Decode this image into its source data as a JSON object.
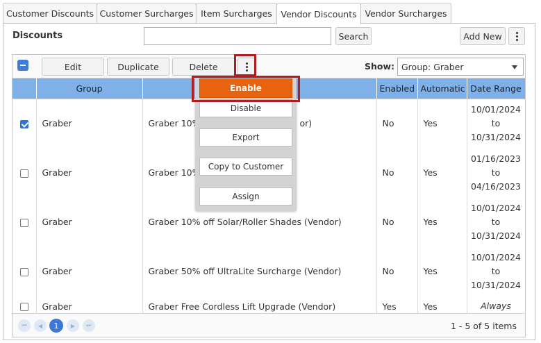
{
  "tabs": [
    {
      "label": "Customer Discounts",
      "active": false
    },
    {
      "label": "Customer Surcharges",
      "active": false
    },
    {
      "label": "Item Surcharges",
      "active": false
    },
    {
      "label": "Vendor Discounts",
      "active": true
    },
    {
      "label": "Vendor Surcharges",
      "active": false
    }
  ],
  "panel": {
    "title": "Discounts",
    "search_value": "",
    "search_label": "Search",
    "add_new_label": "Add New"
  },
  "toolbar": {
    "edit_label": "Edit",
    "duplicate_label": "Duplicate",
    "delete_label": "Delete",
    "show_label": "Show:",
    "show_value": "Group: Graber"
  },
  "columns": [
    "Group",
    "",
    "Enabled",
    "Automatic",
    "Date Range"
  ],
  "rows": [
    {
      "checked": true,
      "group": "Graber",
      "name": "Graber 10% ",
      "name_tail": "or)",
      "enabled": "No",
      "automatic": "Yes",
      "date_from": "10/01/2024",
      "date_to_word": "to",
      "date_to": "10/31/2024"
    },
    {
      "checked": false,
      "group": "Graber",
      "name": "Graber 10%",
      "name_tail": "",
      "enabled": "No",
      "automatic": "Yes",
      "date_from": "01/16/2023",
      "date_to_word": "to",
      "date_to": "04/16/2023"
    },
    {
      "checked": false,
      "group": "Graber",
      "name": "Graber 10% off Solar/Roller Shades (Vendor)",
      "name_tail": "",
      "enabled": "No",
      "automatic": "Yes",
      "date_from": "10/01/2024",
      "date_to_word": "to",
      "date_to": "10/31/2024"
    },
    {
      "checked": false,
      "group": "Graber",
      "name": "Graber 50% off UltraLite Surcharge (Vendor)",
      "name_tail": "",
      "enabled": "No",
      "automatic": "Yes",
      "date_from": "10/01/2024",
      "date_to_word": "to",
      "date_to": "10/31/2024"
    },
    {
      "checked": false,
      "group": "Graber",
      "name": "Graber Free Cordless Lift Upgrade (Vendor)",
      "name_tail": "",
      "enabled": "Yes",
      "automatic": "Yes",
      "always": "Always"
    }
  ],
  "pager": {
    "current_page": "1",
    "info": "1 - 5 of 5 items"
  },
  "menu": {
    "items": [
      "Enable",
      "Disable",
      "Export",
      "Copy to Customer",
      "Assign"
    ]
  },
  "colors": {
    "header_blue": "#7fb0e8",
    "accent_orange": "#e8630f",
    "highlight_red": "#b01e22",
    "checkbox_blue": "#2c74d6"
  }
}
